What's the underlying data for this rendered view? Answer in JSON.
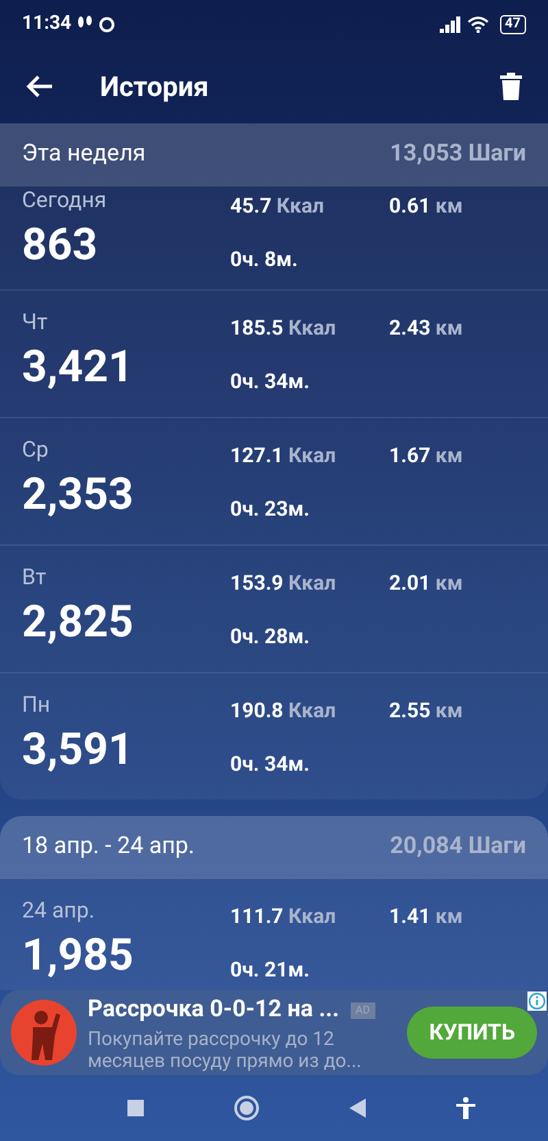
{
  "status_bar": {
    "time": "11:34",
    "battery": "47"
  },
  "app_bar": {
    "title": "История"
  },
  "weeks": [
    {
      "label": "Эта неделя",
      "total": "13,053 Шаги",
      "days": [
        {
          "label": "Сегодня",
          "steps": "863",
          "kcal": "45.7",
          "kcal_unit": "Ккал",
          "km": "0.61",
          "km_unit": "км",
          "duration": "0ч. 8м."
        },
        {
          "label": "Чт",
          "steps": "3,421",
          "kcal": "185.5",
          "kcal_unit": "Ккал",
          "km": "2.43",
          "km_unit": "км",
          "duration": "0ч. 34м."
        },
        {
          "label": "Ср",
          "steps": "2,353",
          "kcal": "127.1",
          "kcal_unit": "Ккал",
          "km": "1.67",
          "km_unit": "км",
          "duration": "0ч. 23м."
        },
        {
          "label": "Вт",
          "steps": "2,825",
          "kcal": "153.9",
          "kcal_unit": "Ккал",
          "km": "2.01",
          "km_unit": "км",
          "duration": "0ч. 28м."
        },
        {
          "label": "Пн",
          "steps": "3,591",
          "kcal": "190.8",
          "kcal_unit": "Ккал",
          "km": "2.55",
          "km_unit": "км",
          "duration": "0ч. 34м."
        }
      ]
    },
    {
      "label": "18 апр. - 24 апр.",
      "total": "20,084 Шаги",
      "days": [
        {
          "label": "24 апр.",
          "steps": "1,985",
          "kcal": "111.7",
          "kcal_unit": "Ккал",
          "km": "1.41",
          "km_unit": "км",
          "duration": "0ч. 21м."
        }
      ]
    }
  ],
  "ad": {
    "title": "Рассрочка 0-0-12 на ...",
    "badge": "AD",
    "text": "Покупайте рассрочку до 12 месяцев посуду прямо из до...",
    "button": "КУПИТЬ"
  }
}
